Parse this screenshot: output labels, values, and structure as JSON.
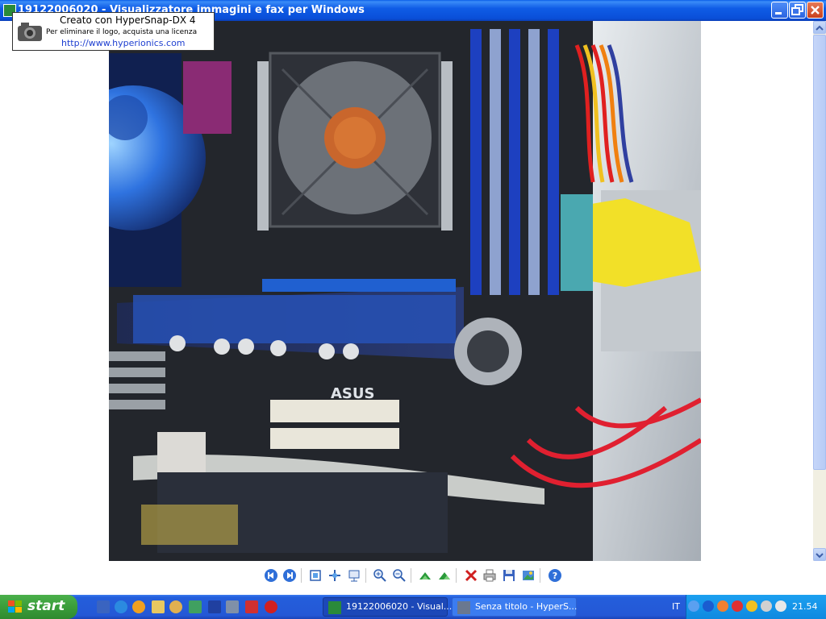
{
  "window": {
    "title": "19122006020 - Visualizzatore immagini e fax per Windows",
    "app_icon": "image-viewer-icon",
    "controls": [
      "minimize-icon",
      "maximize-icon",
      "close-icon"
    ]
  },
  "watermark": {
    "line1": "Creato con HyperSnap-DX 4",
    "line2": "Per eliminare il logo, acquista una licenza",
    "line3": "http://www.hyperionics.com"
  },
  "photo": {
    "subject": "computer-case-motherboard-photo",
    "board_label": "ASUS"
  },
  "toolbar": {
    "buttons": [
      {
        "name": "previous-image-icon"
      },
      {
        "name": "next-image-icon"
      },
      {
        "name": "best-fit-icon"
      },
      {
        "name": "actual-size-icon"
      },
      {
        "name": "slideshow-icon"
      },
      {
        "name": "zoom-in-icon"
      },
      {
        "name": "zoom-out-icon"
      },
      {
        "name": "rotate-clockwise-icon"
      },
      {
        "name": "rotate-counterclockwise-icon"
      },
      {
        "name": "delete-icon"
      },
      {
        "name": "print-icon"
      },
      {
        "name": "copy-to-icon"
      },
      {
        "name": "edit-icon"
      },
      {
        "name": "help-icon"
      }
    ]
  },
  "taskbar": {
    "start_label": "start",
    "quicklaunch": [
      "show-desktop-icon",
      "internet-explorer-icon",
      "media-player-icon",
      "folder-icon",
      "paint-icon",
      "network-icon",
      "save-icon",
      "camera-icon",
      "warning-icon",
      "opera-icon"
    ],
    "tasks": [
      {
        "label": "19122006020 - Visual...",
        "active": true,
        "icon": "image-viewer-icon"
      },
      {
        "label": "Senza titolo - HyperS...",
        "active": false,
        "icon": "hypersnap-icon"
      }
    ],
    "language": "IT",
    "clock": "21.54",
    "tray_icons": [
      "arrow-left-icon",
      "bluetooth-icon",
      "network-icon",
      "antivirus-icon",
      "messenger-icon",
      "update-icon",
      "volume-icon"
    ]
  },
  "colors": {
    "titlebar": "#0a5ee8",
    "taskbar": "#245edb",
    "start": "#3a9d3a",
    "tray": "#0e89e0"
  }
}
